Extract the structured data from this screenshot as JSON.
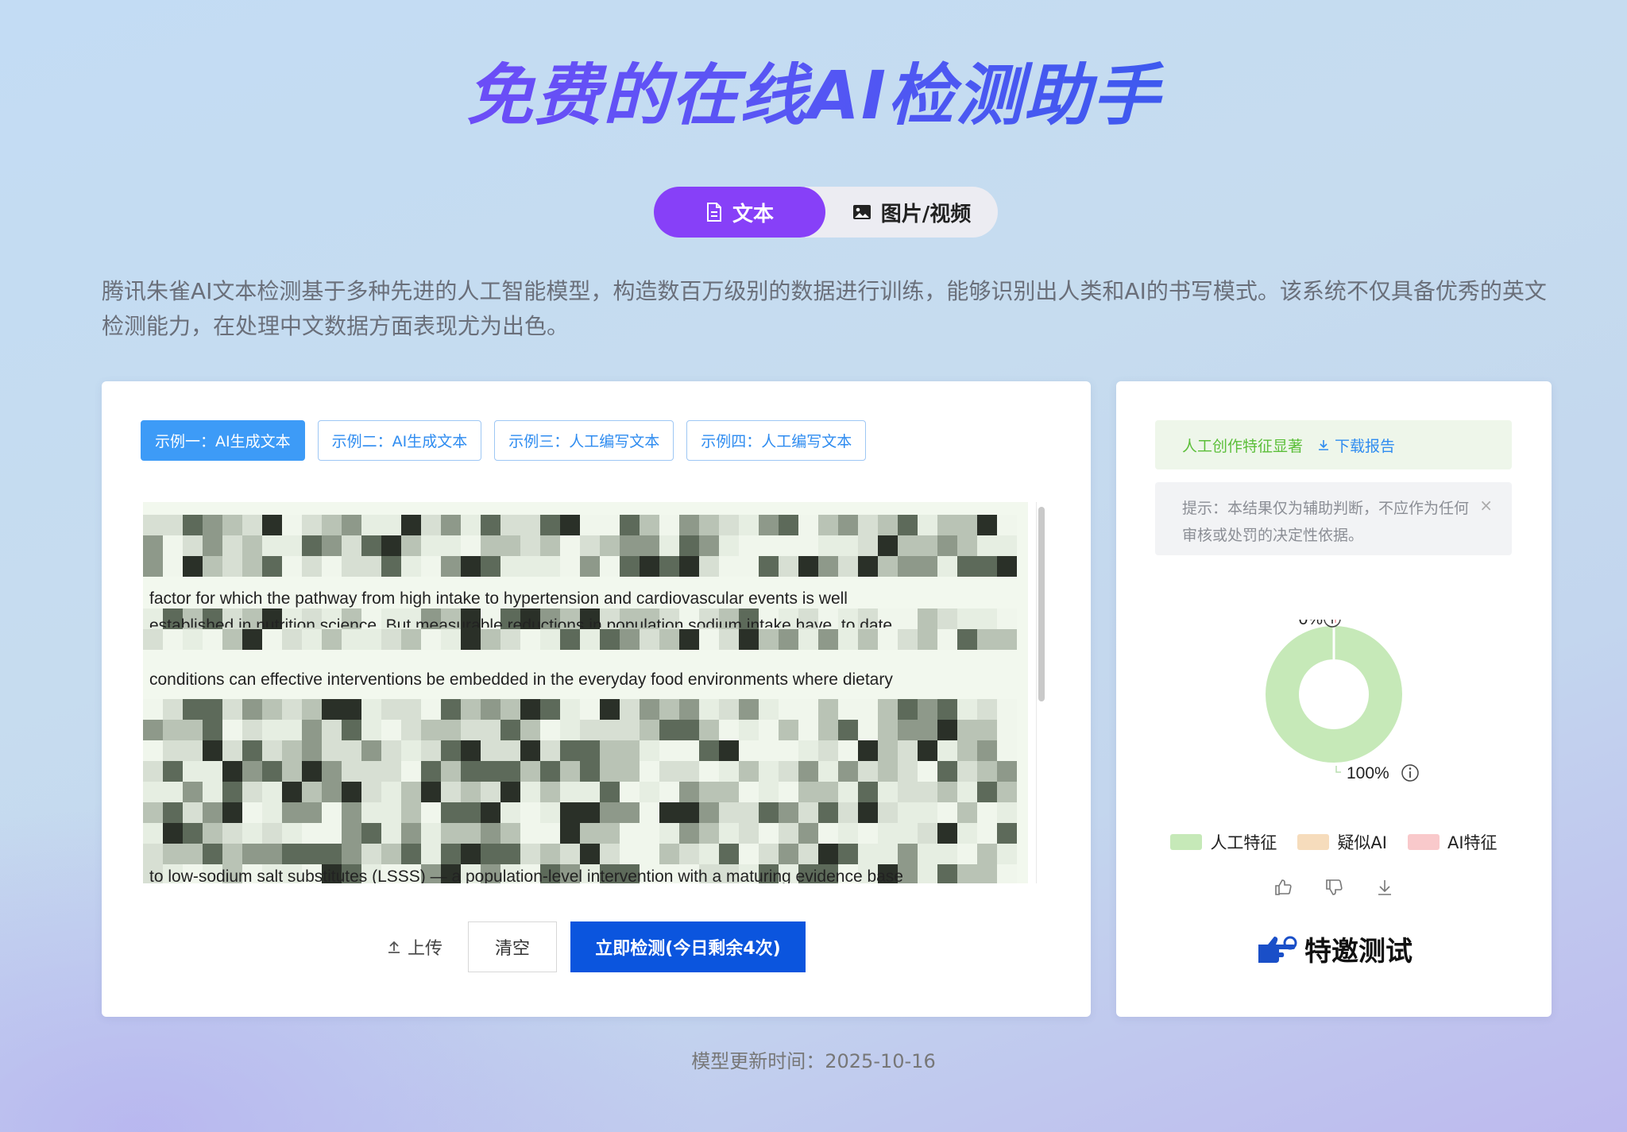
{
  "title": "免费的在线AI检测助手",
  "mode_tabs": [
    {
      "label": "文本",
      "icon": "document-icon",
      "active": true
    },
    {
      "label": "图片/视频",
      "icon": "image-icon",
      "active": false
    }
  ],
  "description": "腾讯朱雀AI文本检测基于多种先进的人工智能模型，构造数百万级别的数据进行训练，能够识别出人类和AI的书写模式。该系统不仅具备优秀的英文检测能力，在处理中文数据方面表现尤为出色。",
  "examples": [
    {
      "label": "示例一：AI生成文本",
      "active": true
    },
    {
      "label": "示例二：AI生成文本",
      "active": false
    },
    {
      "label": "示例三：人工编写文本",
      "active": false
    },
    {
      "label": "示例四：人工编写文本",
      "active": false
    }
  ],
  "textbox": {
    "visible_lines": [
      "factor for which the pathway from high intake to hypertension and cardiovascular events is well",
      "established in nutrition science. But measurable reductions in population sodium intake have, to date,",
      "conditions can effective interventions be embedded in the everyday food environments where dietary",
      "to low-sodium salt substitutes (LSSS) — a population-level intervention with a maturing evidence base"
    ]
  },
  "actions": {
    "upload_label": "上传",
    "clear_label": "清空",
    "detect_label": "立即检测(今日剩余4次)"
  },
  "result": {
    "status": "人工创作特征显著",
    "download_label": "下载报告",
    "tip": "提示：本结果仅为辅助判断，不应作为任何审核或处罚的决定性依据。",
    "close_symbol": "×"
  },
  "chart_data": {
    "type": "pie",
    "labels": [
      "人工特征",
      "疑似AI",
      "AI特征"
    ],
    "values": [
      100,
      0,
      0
    ],
    "value_labels": [
      "100%",
      "0%"
    ],
    "colors": [
      "#c6e9b8",
      "#f6dcbc",
      "#f9c9cb"
    ],
    "legend_placement": "bottom"
  },
  "invite_label": "特邀测试",
  "footer": "模型更新时间：2025-10-16"
}
